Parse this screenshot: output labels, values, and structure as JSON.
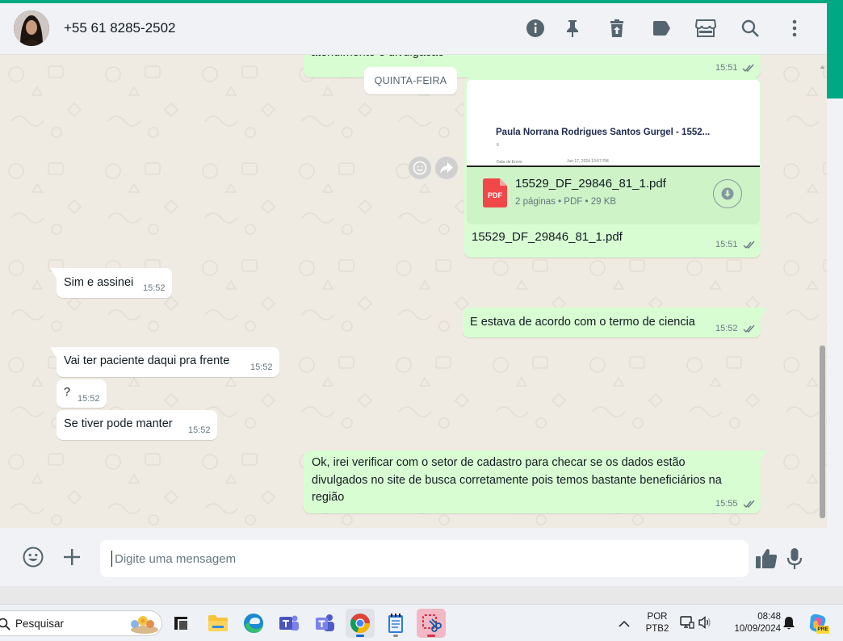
{
  "header": {
    "contact_name": "+55 61 8285-2502",
    "icons": [
      "info-icon",
      "pin-icon",
      "clear-chat-icon",
      "label-icon",
      "catalog-icon",
      "search-icon",
      "menu-icon"
    ]
  },
  "chat": {
    "partial_message": {
      "text": "atendimento e divulgacao",
      "time": "15:51",
      "status": "read"
    },
    "date_divider": "QUINTA-FEIRA",
    "document_message": {
      "preview_title": "Paula Norrana Rodrigues Santos Gurgel - 1552...",
      "preview_small_left": "Data de Envio",
      "preview_small_right": "Jun 17, 2024 10:57 PM",
      "preview_small_top": "6",
      "file_name": "15529_DF_29846_81_1.pdf",
      "file_meta": "2 páginas • PDF • 29 KB",
      "file_type_badge": "PDF",
      "caption": "15529_DF_29846_81_1.pdf",
      "time": "15:51",
      "status": "read"
    },
    "messages": [
      {
        "direction": "in",
        "text": "Sim e assinei",
        "time": "15:52"
      },
      {
        "direction": "out",
        "text": "E estava de acordo com o termo de ciencia",
        "time": "15:52",
        "status": "read"
      },
      {
        "direction": "in",
        "text": "Vai ter paciente daqui pra frente",
        "time": "15:52"
      },
      {
        "direction": "in",
        "text": "?",
        "time": "15:52"
      },
      {
        "direction": "in",
        "text": "Se tiver pode manter",
        "time": "15:52"
      },
      {
        "direction": "out",
        "lines": [
          "Ok, irei verificar com o setor de cadastro para checar se os dados estão",
          "divulgados no site de busca corretamente pois temos bastante beneficiários na",
          "região"
        ],
        "time": "15:55",
        "status": "read"
      }
    ]
  },
  "composer": {
    "placeholder": "Digite uma mensagem"
  },
  "taskbar": {
    "search_label": "Pesquisar",
    "language_line1": "POR",
    "language_line2": "PTB2",
    "clock_time": "08:48",
    "clock_date": "10/09/2024",
    "copilot_badge": "PRE",
    "apps": [
      "task-view",
      "file-explorer",
      "edge",
      "teams-classic",
      "teams",
      "chrome",
      "notepad",
      "snipping-tool"
    ]
  },
  "colors": {
    "accent": "#00a884",
    "outgoing_bubble": "#d9fdd3",
    "incoming_bubble": "#ffffff",
    "chat_background": "#efeae2",
    "read_ticks": "#667781",
    "pdf_red": "#f04848"
  }
}
